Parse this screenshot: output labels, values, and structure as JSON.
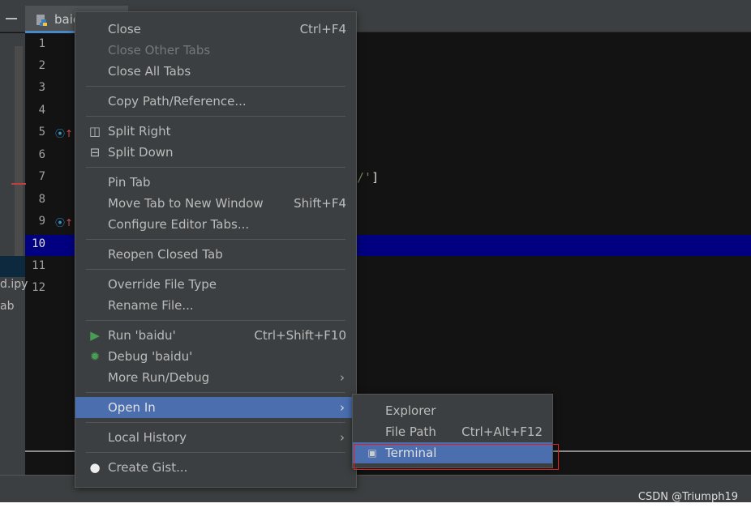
{
  "tab": {
    "label": "baidu",
    "icon": "python-file-icon"
  },
  "left_fragments": [
    "d.ipy",
    "ab"
  ],
  "line_numbers": [
    "1",
    "2",
    "3",
    "4",
    "5",
    "6",
    "7",
    "8",
    "9",
    "10",
    "11",
    "12"
  ],
  "current_line": "10",
  "code_fragment": {
    "green": "/'",
    "rest": "]"
  },
  "menu": {
    "close": {
      "label": "Close",
      "shortcut": "Ctrl+F4"
    },
    "close_other": "Close Other Tabs",
    "close_all": "Close All Tabs",
    "copy_path": "Copy Path/Reference...",
    "split_right": "Split Right",
    "split_down": "Split Down",
    "pin_tab": "Pin Tab",
    "move_tab": {
      "label": "Move Tab to New Window",
      "shortcut": "Shift+F4"
    },
    "configure_tabs": "Configure Editor Tabs...",
    "reopen": "Reopen Closed Tab",
    "override_type": "Override File Type",
    "rename": "Rename File...",
    "run": {
      "label": "Run 'baidu'",
      "shortcut": "Ctrl+Shift+F10"
    },
    "debug": "Debug 'baidu'",
    "more_run": "More Run/Debug",
    "open_in": "Open In",
    "local_history": "Local History",
    "create_gist": "Create Gist..."
  },
  "submenu": {
    "explorer": "Explorer",
    "file_path": {
      "label": "File Path",
      "shortcut": "Ctrl+Alt+F12"
    },
    "terminal": "Terminal"
  },
  "watermark": "CSDN @Triumph19",
  "colors": {
    "selection": "#4b6eaf",
    "highlight_box": "#e02020",
    "current_line": "#000080"
  }
}
